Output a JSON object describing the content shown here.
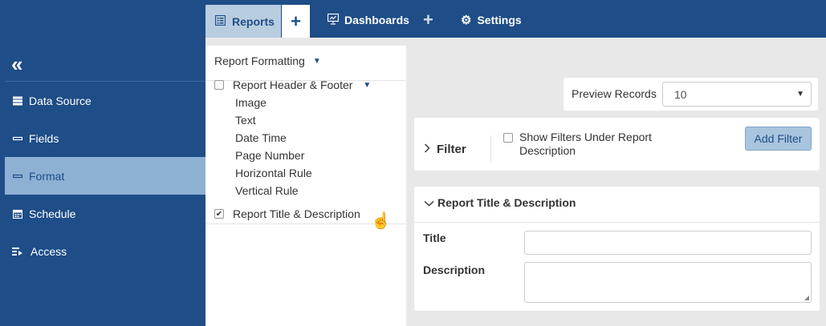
{
  "topbar": {
    "reports_label": "Reports",
    "add_label": "+",
    "dashboards_label": "Dashboards",
    "add_dashboard_label": "+",
    "settings_label": "Settings"
  },
  "sidebar": {
    "collapse_glyph": "«",
    "items": [
      {
        "label": "Data Source",
        "icon": "database-icon",
        "active": false
      },
      {
        "label": "Fields",
        "icon": "minus-icon",
        "active": false
      },
      {
        "label": "Format",
        "icon": "minus-icon",
        "active": true
      },
      {
        "label": "Schedule",
        "icon": "calendar-icon",
        "active": false
      },
      {
        "label": "Access",
        "icon": "access-list-icon",
        "active": false
      }
    ]
  },
  "format_panel": {
    "title": "Report Formatting",
    "header_footer": {
      "label": "Report Header & Footer",
      "checked": false
    },
    "sub_items": [
      "Image",
      "Text",
      "Date Time",
      "Page Number",
      "Horizontal Rule",
      "Vertical Rule"
    ],
    "title_description": {
      "label": "Report Title & Description",
      "checked": true
    }
  },
  "preview": {
    "label": "Preview Records",
    "value": "10"
  },
  "filter": {
    "label": "Filter",
    "show_filters_label": "Show Filters Under Report Description",
    "show_filters_checked": false,
    "add_button": "Add Filter"
  },
  "title_section": {
    "heading": "Report Title & Description",
    "title_label": "Title",
    "title_value": "",
    "description_label": "Description",
    "description_value": ""
  },
  "colors": {
    "brand": "#1e4d87",
    "active_tab": "#b9cde0",
    "active_sidebar": "#8eb0d3",
    "button": "#a9c4dd"
  }
}
